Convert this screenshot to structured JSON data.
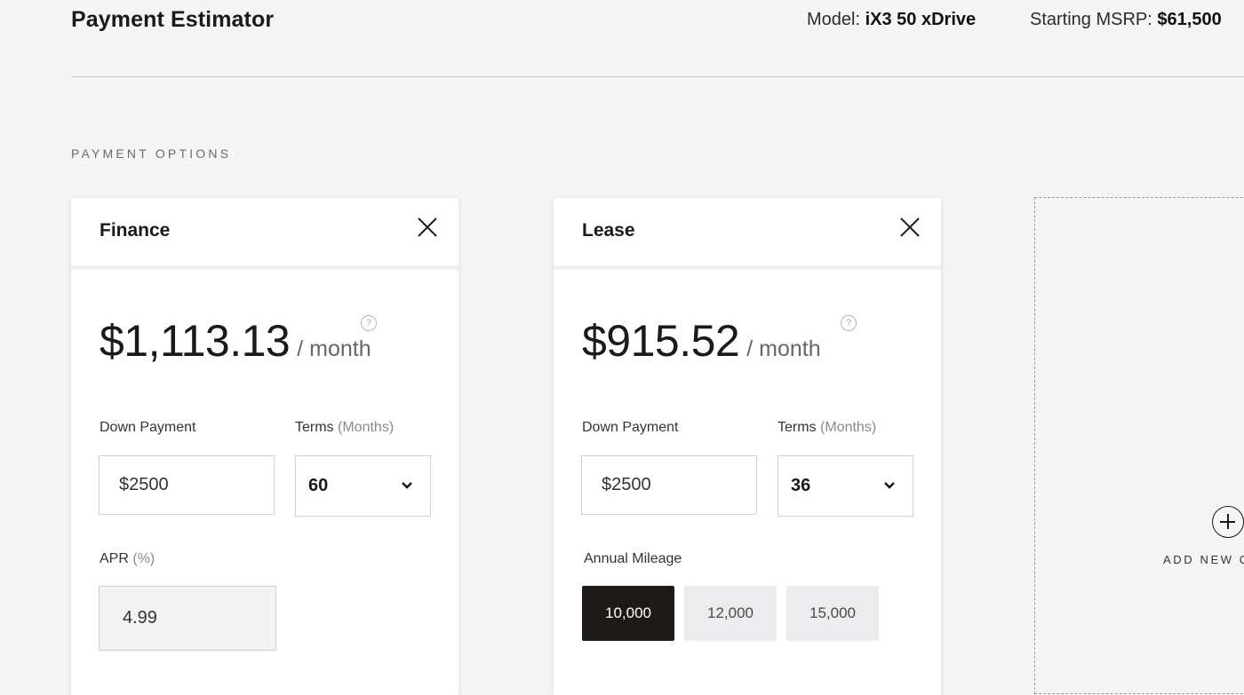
{
  "header": {
    "title": "Payment Estimator",
    "model_label": "Model:",
    "model_value": "iX3 50 xDrive",
    "msrp_label": "Starting MSRP:",
    "msrp_value": "$61,500"
  },
  "section_label": "PAYMENT OPTIONS",
  "finance": {
    "title": "Finance",
    "amount": "$1,113.13",
    "per": "/ month",
    "down_payment_label": "Down Payment",
    "down_payment_value": "$2500",
    "terms_label": "Terms",
    "terms_unit": "(Months)",
    "terms_value": "60",
    "apr_label": "APR",
    "apr_unit": "(%)",
    "apr_value": "4.99"
  },
  "lease": {
    "title": "Lease",
    "amount": "$915.52",
    "per": "/ month",
    "down_payment_label": "Down Payment",
    "down_payment_value": "$2500",
    "terms_label": "Terms",
    "terms_unit": "(Months)",
    "terms_value": "36",
    "mileage_label": "Annual Mileage",
    "mileage_options": [
      "10,000",
      "12,000",
      "15,000"
    ],
    "mileage_selected": "10,000"
  },
  "add_option": {
    "label": "ADD NEW O"
  },
  "help_glyph": "?",
  "icons": [
    "close-icon",
    "help-icon",
    "chevron-down-icon",
    "plus-circle-icon"
  ]
}
